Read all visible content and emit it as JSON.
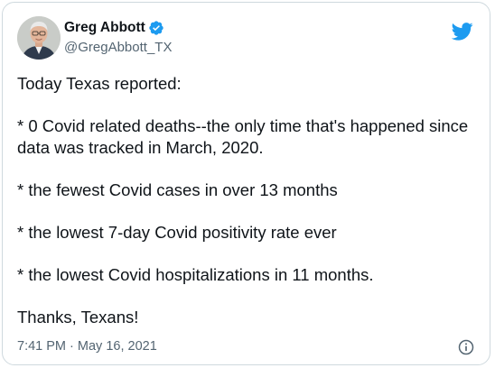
{
  "tweet": {
    "author": {
      "display_name": "Greg Abbott",
      "handle": "@GregAbbott_TX",
      "verified": true
    },
    "lines": [
      "Today Texas reported:",
      "* 0 Covid related deaths--the only time that's happened since data was tracked in March, 2020.",
      "* the fewest Covid cases in over 13 months",
      "* the lowest 7-day Covid positivity rate ever",
      "* the lowest Covid hospitalizations in 11 months.",
      "Thanks, Texans!"
    ],
    "time": "7:41 PM",
    "separator": "·",
    "date": "May 16, 2021"
  },
  "icons": {
    "brand": "twitter-bird-icon",
    "verified": "verified-badge-icon",
    "info": "info-icon"
  },
  "colors": {
    "brand_blue": "#1d9bf0",
    "text": "#0f1419",
    "muted": "#536471",
    "border": "#cfd9de"
  }
}
